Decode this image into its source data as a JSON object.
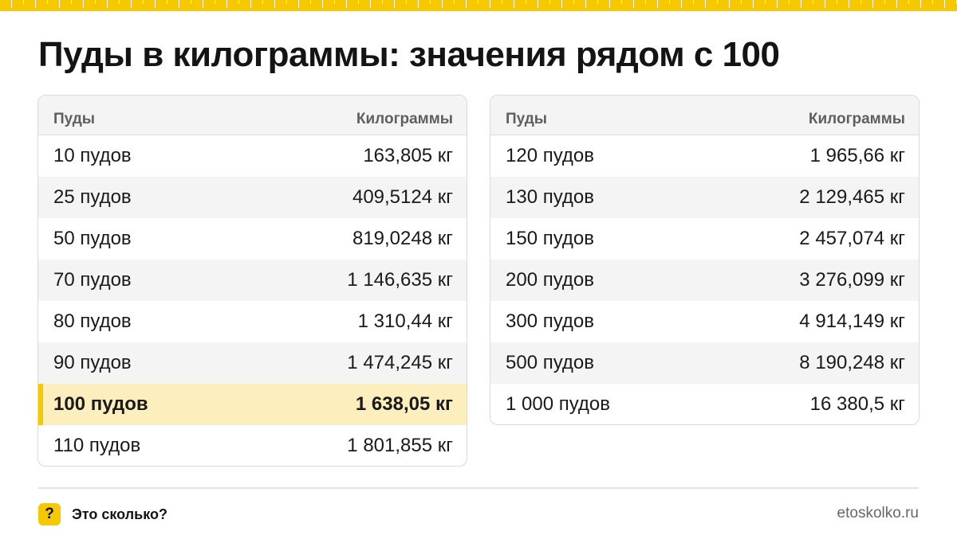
{
  "title": "Пуды в килограммы: значения рядом с 100",
  "tables": [
    {
      "header": {
        "col1": "Пуды",
        "col2": "Килограммы"
      },
      "rows": [
        {
          "puds": "10 пудов",
          "kg": "163,805 кг"
        },
        {
          "puds": "25 пудов",
          "kg": "409,5124 кг"
        },
        {
          "puds": "50 пудов",
          "kg": "819,0248 кг"
        },
        {
          "puds": "70 пудов",
          "kg": "1 146,635 кг"
        },
        {
          "puds": "80 пудов",
          "kg": "1 310,44 кг"
        },
        {
          "puds": "90 пудов",
          "kg": "1 474,245 кг"
        },
        {
          "puds": "100 пудов",
          "kg": "1 638,05 кг",
          "highlighted": true
        },
        {
          "puds": "110 пудов",
          "kg": "1 801,855 кг"
        }
      ]
    },
    {
      "header": {
        "col1": "Пуды",
        "col2": "Килограммы"
      },
      "rows": [
        {
          "puds": "120 пудов",
          "kg": "1 965,66 кг"
        },
        {
          "puds": "130 пудов",
          "kg": "2 129,465 кг"
        },
        {
          "puds": "150 пудов",
          "kg": "2 457,074 кг"
        },
        {
          "puds": "200 пудов",
          "kg": "3 276,099 кг"
        },
        {
          "puds": "300 пудов",
          "kg": "4 914,149 кг"
        },
        {
          "puds": "500 пудов",
          "kg": "8 190,248 кг"
        },
        {
          "puds": "1 000 пудов",
          "kg": "16 380,5 кг"
        }
      ]
    }
  ],
  "footer": {
    "logo_mark": "?",
    "logo_icon": "question-mark-icon",
    "logo_text": "Это сколько?",
    "url": "etoskolko.ru"
  },
  "colors": {
    "accent": "#f5c800",
    "highlight_row": "#fcefbd",
    "alt_row": "#f4f4f4",
    "header_text": "#5f5f5f"
  }
}
